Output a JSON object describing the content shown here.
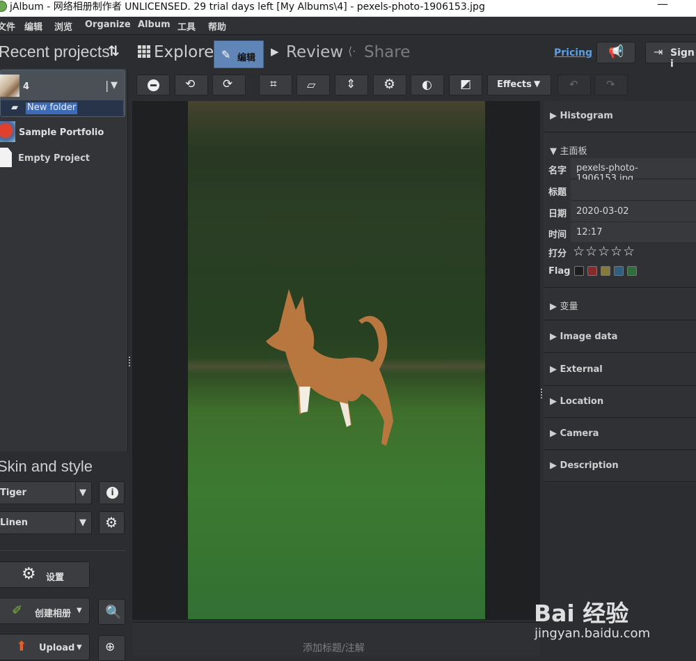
{
  "window": {
    "title": "jAlbum - 网络相册制作者 UNLICENSED. 29 trial days left [My Albums\\4] - pexels-photo-1906153.jpg"
  },
  "menu": [
    "文件",
    "编辑",
    "浏览",
    "Organize",
    "Album",
    "工具",
    "帮助"
  ],
  "recent": {
    "heading": "Recent projects",
    "current_project": "4",
    "selected_folder": "New folder",
    "items": [
      "Sample Portfolio",
      "Empty Project"
    ]
  },
  "tabs": {
    "explore": "Explore",
    "edit": "编辑",
    "review": "Review",
    "share": "Share"
  },
  "header_right": {
    "pricing": "Pricing",
    "sign_in": "Sign i"
  },
  "toolbar": {
    "effects": "Effects"
  },
  "skin": {
    "heading": "Skin and style",
    "skin": "Tiger",
    "style": "Linen"
  },
  "actions": {
    "settings": "设置",
    "make_album": "创建相册",
    "upload": "Upload"
  },
  "caption": {
    "placeholder": "添加标题/注解"
  },
  "right": {
    "histogram": "Histogram",
    "main_panel": "主面板",
    "fields": {
      "name_label": "名字",
      "name": "pexels-photo-1906153.jpg",
      "title_label": "标题",
      "title": "",
      "date_label": "日期",
      "date": "2020-03-02",
      "time_label": "时间",
      "time": "12:17",
      "rating_label": "打分",
      "flag_label": "Flag"
    },
    "rating": 0,
    "flag_colors": [
      "#1e1e1e",
      "#8b2a2a",
      "#857a3c",
      "#2f5f80",
      "#2e6e38"
    ],
    "sections": [
      "变量",
      "Image data",
      "External",
      "Location",
      "Camera",
      "Description"
    ]
  },
  "watermark": {
    "brand": "Bai 经验",
    "url": "jingyan.baidu.com"
  }
}
